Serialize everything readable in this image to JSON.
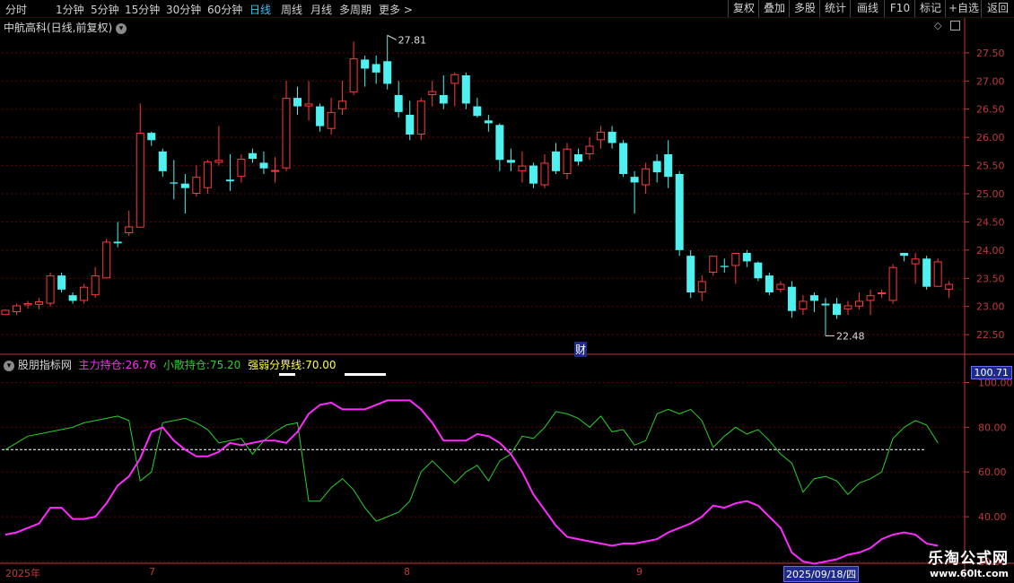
{
  "toolbar": {
    "periods": [
      "分时",
      "1分钟",
      "5分钟",
      "15分钟",
      "30分钟",
      "60分钟",
      "日线",
      "周线",
      "月线",
      "多周期",
      "更多 >"
    ],
    "active_period": "日线",
    "right_buttons": [
      "复权",
      "叠加",
      "多股",
      "统计",
      "画线",
      "F10",
      "标记",
      "+自选",
      "返回"
    ]
  },
  "main_panel": {
    "title": "中航高科(日线,前复权)",
    "marker_left": "",
    "marker_caibao": "财"
  },
  "indicator_panel": {
    "name": "股朋指标网",
    "main_label": "主力持仓:",
    "main_value": "26.76",
    "retail_label": "小散持仓:",
    "retail_value": "75.20",
    "boundary_label": "强弱分界线:",
    "boundary_value": "70.00",
    "price_tag": "100.71"
  },
  "time_axis": {
    "labels": [
      "2025年",
      "7",
      "8",
      "9"
    ],
    "cursor_date": "2025/09/18/四"
  },
  "watermark": {
    "title": "乐淘公式网",
    "url": "www.60lt.com"
  },
  "colors": {
    "up": "#ff3b3b",
    "down": "#4ef0f0",
    "main": "#ff2bff",
    "retail": "#28d028",
    "boundary": "#ffffff",
    "grid": "#6a0000",
    "axis": "#c03a3a"
  },
  "chart_data": [
    {
      "type": "candlestick",
      "title": "中航高科(日线,前复权)",
      "ylim": [
        22.2,
        27.8
      ],
      "y_ticks": [
        22.5,
        23.0,
        23.5,
        24.0,
        24.5,
        25.0,
        25.5,
        26.0,
        26.5,
        27.0,
        27.5
      ],
      "annotations": [
        {
          "label": "27.81",
          "type": "high"
        },
        {
          "label": "22.48",
          "type": "low"
        }
      ],
      "candles": [
        [
          22.85,
          22.94,
          22.95,
          22.85
        ],
        [
          22.9,
          23.02,
          23.05,
          22.85
        ],
        [
          23.02,
          23.06,
          23.1,
          22.96
        ],
        [
          23.03,
          23.09,
          23.15,
          22.95
        ],
        [
          23.05,
          23.55,
          23.6,
          23.0
        ],
        [
          23.55,
          23.3,
          23.6,
          23.25
        ],
        [
          23.2,
          23.1,
          23.25,
          23.05
        ],
        [
          23.1,
          23.35,
          23.4,
          23.05
        ],
        [
          23.2,
          23.55,
          23.7,
          23.15
        ],
        [
          23.5,
          24.15,
          24.2,
          23.5
        ],
        [
          24.15,
          24.12,
          24.5,
          24.05
        ],
        [
          24.3,
          24.42,
          24.7,
          24.25
        ],
        [
          24.4,
          26.08,
          26.6,
          24.4
        ],
        [
          26.08,
          25.95,
          26.1,
          25.85
        ],
        [
          25.75,
          25.4,
          25.8,
          25.3
        ],
        [
          25.2,
          25.18,
          25.6,
          24.9
        ],
        [
          25.18,
          25.1,
          25.35,
          24.65
        ],
        [
          25.0,
          25.3,
          25.5,
          24.95
        ],
        [
          25.1,
          25.57,
          25.6,
          25.0
        ],
        [
          25.55,
          25.6,
          26.2,
          25.5
        ],
        [
          25.25,
          25.22,
          25.7,
          25.05
        ],
        [
          25.3,
          25.62,
          25.7,
          25.2
        ],
        [
          25.72,
          25.62,
          25.8,
          25.55
        ],
        [
          25.55,
          25.45,
          25.75,
          25.35
        ],
        [
          25.4,
          25.42,
          25.65,
          25.2
        ],
        [
          25.45,
          26.7,
          27.0,
          25.4
        ],
        [
          26.7,
          26.55,
          26.9,
          26.4
        ],
        [
          26.55,
          26.6,
          27.0,
          26.3
        ],
        [
          26.55,
          26.2,
          26.6,
          26.1
        ],
        [
          26.15,
          26.45,
          26.7,
          26.05
        ],
        [
          26.5,
          26.65,
          27.0,
          26.4
        ],
        [
          26.8,
          27.4,
          27.7,
          26.75
        ],
        [
          27.38,
          27.22,
          27.45,
          26.9
        ],
        [
          27.3,
          27.15,
          27.45,
          26.95
        ],
        [
          27.35,
          26.95,
          27.81,
          26.85
        ],
        [
          26.75,
          26.45,
          27.0,
          26.35
        ],
        [
          26.4,
          26.05,
          26.65,
          25.95
        ],
        [
          26.05,
          26.65,
          26.7,
          25.95
        ],
        [
          26.75,
          26.82,
          27.0,
          26.55
        ],
        [
          26.75,
          26.6,
          27.1,
          26.5
        ],
        [
          26.95,
          27.12,
          27.15,
          26.55
        ],
        [
          27.1,
          26.6,
          27.15,
          26.5
        ],
        [
          26.55,
          26.38,
          26.7,
          26.35
        ],
        [
          26.3,
          26.25,
          26.4,
          26.1
        ],
        [
          26.22,
          25.6,
          26.25,
          25.4
        ],
        [
          25.6,
          25.55,
          25.8,
          25.4
        ],
        [
          25.4,
          25.5,
          25.75,
          25.2
        ],
        [
          25.5,
          25.18,
          25.55,
          25.1
        ],
        [
          25.15,
          25.55,
          25.7,
          25.1
        ],
        [
          25.75,
          25.4,
          25.9,
          25.35
        ],
        [
          25.35,
          25.8,
          25.9,
          25.25
        ],
        [
          25.7,
          25.57,
          25.8,
          25.5
        ],
        [
          25.7,
          25.85,
          26.0,
          25.6
        ],
        [
          25.95,
          26.1,
          26.2,
          25.8
        ],
        [
          26.1,
          25.9,
          26.2,
          25.8
        ],
        [
          25.9,
          25.35,
          25.95,
          25.3
        ],
        [
          25.3,
          25.2,
          25.4,
          24.65
        ],
        [
          25.15,
          25.45,
          25.55,
          25.0
        ],
        [
          25.58,
          25.38,
          25.7,
          25.2
        ],
        [
          25.7,
          25.3,
          25.95,
          25.1
        ],
        [
          25.35,
          24.0,
          25.4,
          23.9
        ],
        [
          23.9,
          23.25,
          24.0,
          23.15
        ],
        [
          23.25,
          23.45,
          23.55,
          23.1
        ],
        [
          23.6,
          23.9,
          23.9,
          23.55
        ],
        [
          23.72,
          23.7,
          23.85,
          23.6
        ],
        [
          23.72,
          23.95,
          23.95,
          23.4
        ],
        [
          23.95,
          23.8,
          24.0,
          23.7
        ],
        [
          23.78,
          23.5,
          23.8,
          23.45
        ],
        [
          23.55,
          23.25,
          23.6,
          23.2
        ],
        [
          23.3,
          23.4,
          23.45,
          23.25
        ],
        [
          23.35,
          22.92,
          23.45,
          22.8
        ],
        [
          22.95,
          23.1,
          23.2,
          22.85
        ],
        [
          23.2,
          23.1,
          23.25,
          22.9
        ],
        [
          23.05,
          23.02,
          23.15,
          22.48
        ],
        [
          23.05,
          22.85,
          23.15,
          22.78
        ],
        [
          22.95,
          23.02,
          23.1,
          22.85
        ],
        [
          23.0,
          23.1,
          23.25,
          22.95
        ],
        [
          23.1,
          23.2,
          23.3,
          22.85
        ],
        [
          23.25,
          23.25,
          23.3,
          23.15
        ],
        [
          23.1,
          23.7,
          23.75,
          23.05
        ],
        [
          23.95,
          23.9,
          23.95,
          23.8
        ],
        [
          23.75,
          23.85,
          23.95,
          23.4
        ],
        [
          23.85,
          23.35,
          23.9,
          23.3
        ],
        [
          23.35,
          23.8,
          23.85,
          23.35
        ],
        [
          23.3,
          23.4,
          23.45,
          23.15
        ]
      ]
    },
    {
      "type": "line",
      "title": "股朋指标网",
      "ylim": [
        20,
        101
      ],
      "y_ticks": [
        20,
        40,
        60,
        80,
        100
      ],
      "series": [
        {
          "name": "主力持仓",
          "values": [
            32,
            33,
            35,
            37,
            44,
            44,
            39,
            39,
            40,
            46,
            54,
            58,
            66,
            78,
            80,
            74,
            70,
            67,
            67,
            69,
            73,
            72,
            73,
            74,
            74,
            73,
            78,
            86,
            90,
            91,
            88,
            88,
            88,
            90,
            92,
            92,
            92,
            88,
            82,
            74,
            74,
            74,
            77,
            76,
            73,
            68,
            60,
            50,
            43,
            36,
            31,
            30,
            29,
            28,
            27,
            28,
            28,
            29,
            30,
            33,
            35,
            37,
            40,
            45,
            44,
            46,
            47,
            45,
            40,
            35,
            24,
            20,
            19,
            20,
            21,
            23,
            24,
            26,
            30,
            32,
            33,
            32,
            28,
            27
          ]
        },
        {
          "name": "小散持仓",
          "values": [
            70,
            73,
            76,
            77,
            78,
            79,
            80,
            82,
            83,
            84,
            85,
            83,
            56,
            60,
            82,
            83,
            84,
            82,
            79,
            73,
            74,
            75,
            68,
            74,
            78,
            81,
            82,
            47,
            47,
            53,
            57,
            52,
            44,
            38,
            40,
            42,
            47,
            60,
            65,
            60,
            55,
            60,
            63,
            56,
            65,
            68,
            76,
            75,
            80,
            87,
            86,
            84,
            80,
            85,
            78,
            79,
            72,
            74,
            86,
            88,
            86,
            88,
            83,
            71,
            76,
            80,
            77,
            79,
            74,
            68,
            64,
            51,
            57,
            58,
            56,
            50,
            55,
            57,
            60,
            75,
            80,
            83,
            81,
            73
          ]
        },
        {
          "name": "强弱分界线",
          "values": [
            70
          ]
        }
      ]
    }
  ]
}
